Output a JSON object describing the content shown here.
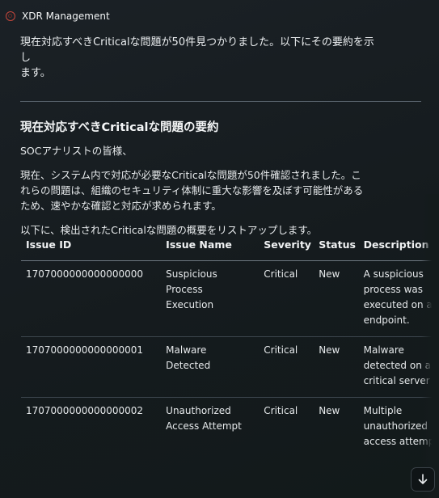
{
  "app": {
    "title": "XDR Management",
    "logo_icon": "xdr-logo-icon"
  },
  "message": {
    "intro_line1": "現在対応すべきCriticalな問題が50件見つかりました。以下にその要約を示し",
    "intro_line2": "ます。",
    "section_title": "現在対応すべきCriticalな問題の要約",
    "greeting": "SOCアナリストの皆様、",
    "body_line1": "現在、システム内で対応が必要なCriticalな問題が50件確認されました。こ",
    "body_line2": "れらの問題は、組織のセキュリティ体制に重大な影響を及ぼす可能性がある",
    "body_line3": "ため、速やかな確認と対応が求められます。",
    "list_intro": "以下に、検出されたCriticalな問題の概要をリストアップします。"
  },
  "table": {
    "headers": {
      "id": "Issue ID",
      "name": "Issue Name",
      "severity": "Severity",
      "status": "Status",
      "description": "Description"
    },
    "rows": [
      {
        "id": "1707000000000000000",
        "name_lines": [
          "Suspicious",
          "Process",
          "Execution"
        ],
        "severity": "Critical",
        "status": "New",
        "desc_lines": [
          "A suspicious",
          "process was",
          "executed on a",
          "endpoint."
        ]
      },
      {
        "id": "1707000000000000001",
        "name_lines": [
          "Malware",
          "Detected"
        ],
        "severity": "Critical",
        "status": "New",
        "desc_lines": [
          "Malware",
          "detected on a",
          "critical server"
        ]
      },
      {
        "id": "1707000000000000002",
        "name_lines": [
          "Unauthorized",
          "Access Attempt"
        ],
        "severity": "Critical",
        "status": "New",
        "desc_lines": [
          "Multiple",
          "unauthorized",
          "access attempt"
        ]
      }
    ]
  },
  "controls": {
    "scroll_down_icon": "arrow-down-icon"
  },
  "colors": {
    "background": "#161c1f",
    "text": "#e9ecee",
    "logo_accent": "#c6473c"
  }
}
